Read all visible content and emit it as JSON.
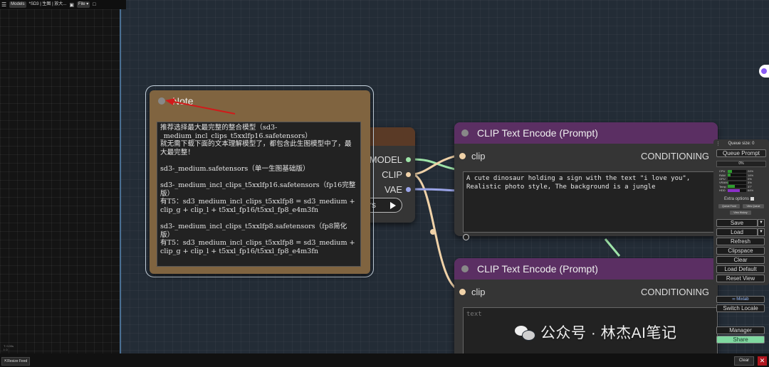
{
  "topbar": {
    "models_label": "Models",
    "workflow_name": "*SD3 | 生图 | 放大...",
    "file_label": "File",
    "file_chevron": "▾",
    "menu_icon": "menu-icon",
    "image_icon": "image-icon",
    "save_icon": "save-icon"
  },
  "canvas": {
    "coords_line1": "T: 0.00s",
    "coords_line2": "I: 0"
  },
  "note": {
    "title": "Note",
    "body": "推荐选择最大最完整的整合模型（sd3-_medium_incl_clips_t5xxlfp16.safetensors）\n就无需下载下面的文本理解模型了，都包含此生图模型中了，最大最完整！\n\nsd3-_medium.safetensors（单一生图基础版）\n\nsd3-_medium_incl_clips_t5xxlfp16.safetensors（fp16完整版）\n有T5：sd3_medium_incl_clips_t5xxlfp8 = sd3_medium + clip_g + clip_l + t5xxl_fp16/t5xxl_fp8_e4m3fn\n\nsd3-_medium_incl_clips_t5xxlfp8.safetensors（fp8简化版）\n有T5：sd3_medium_incl_clips_t5xxlfp8 = sd3_medium + clip_g + clip_l + t5xxl_fp16/t5xxl_fp8_e4m3fn"
  },
  "loader": {
    "outputs": [
      "MODEL",
      "CLIP",
      "VAE"
    ],
    "output_colors": [
      "#9ee4a8",
      "#f0d2a8",
      "#9aa4e8"
    ],
    "widget_fragment": "rs"
  },
  "clip_nodes": [
    {
      "title": "CLIP Text Encode (Prompt)",
      "input": "clip",
      "output": "CONDITIONING",
      "text": "A cute dinosaur holding a sign with the text \"i love you\",\nRealistic photo style, The background is a jungle"
    },
    {
      "title": "CLIP Text Encode (Prompt)",
      "input": "clip",
      "output": "CONDITIONING",
      "text": "text"
    }
  ],
  "queue_panel": {
    "queue_size": "Queue size: 0",
    "queue_prompt": "Queue Prompt",
    "progress": "0%",
    "stats": [
      {
        "label": "CPU",
        "value": "24%",
        "fraction": 0.24,
        "color": "#2e9c2e"
      },
      {
        "label": "RAM",
        "value": "14%",
        "fraction": 0.14,
        "color": "#2e9c2e"
      },
      {
        "label": "GPU",
        "value": "0%",
        "fraction": 0.0,
        "color": "#2e9c2e"
      },
      {
        "label": "VRAM",
        "value": "3%",
        "fraction": 0.03,
        "color": "#2e9c2e"
      },
      {
        "label": "Temp",
        "value": "37°",
        "fraction": 0.37,
        "color": "#2e9c2e"
      },
      {
        "label": "HDD",
        "value": "64%",
        "fraction": 0.64,
        "color": "#8b2fc9"
      }
    ],
    "extra_options": "Extra options",
    "queue_front": "Queue Front",
    "view_queue": "View Queue",
    "view_history": "View History",
    "buttons": [
      "Save",
      "Load",
      "Refresh",
      "Clipspace",
      "Clear",
      "Load Default",
      "Reset View"
    ],
    "mixlab": "∞ Mixlab",
    "switch_locale": "Switch Locale",
    "manager": "Manager",
    "share": "Share"
  },
  "bottom": {
    "resize_feed": "Resize Feed",
    "clear": "Clear",
    "close": "✕"
  },
  "watermark": {
    "text": "公众号 · 林杰AI笔记"
  },
  "colors": {
    "canvas": "#232c36",
    "note": "#806440",
    "clip_header": "#5b2f63",
    "node_body": "#353535",
    "link_green": "#9ee4a8",
    "link_tan": "#f0d2a8",
    "link_blue": "#9aa4e8",
    "arrow_red": "#d11a1a"
  }
}
